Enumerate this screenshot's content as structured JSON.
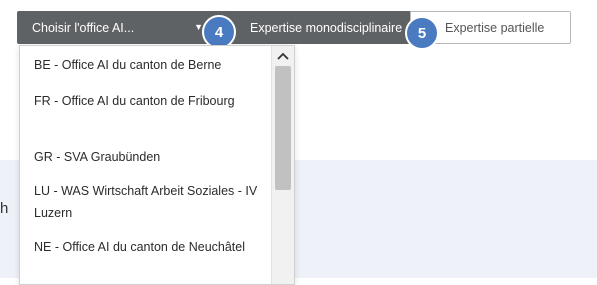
{
  "toolbar": {
    "office_select_label": "Choisir l'office AI...",
    "mono_label": "Expertise monodisciplinaire",
    "partial_label": "Expertise partielle",
    "badge_4": "4",
    "badge_5": "5"
  },
  "background": {
    "partial_text": "h"
  },
  "dropdown": {
    "items": [
      "BE - Office AI du canton de Berne",
      "FR - Office AI du canton de Fribourg",
      "GR - SVA Graubünden",
      "LU - WAS Wirtschaft Arbeit Soziales - IV Luzern",
      "NE - Office AI du canton de Neuchâtel"
    ]
  },
  "colors": {
    "button_dark": "#5f6265",
    "badge_blue": "#4a7bc0",
    "band": "#eef2f8"
  },
  "icons": {
    "dropdown_caret": "chevron-down-icon",
    "scroll_up": "scroll-up-arrow-icon"
  }
}
